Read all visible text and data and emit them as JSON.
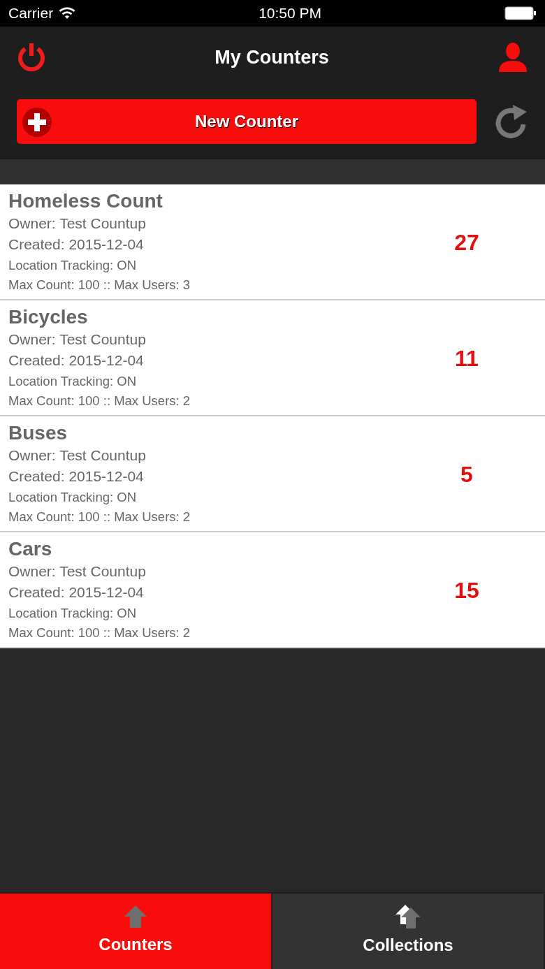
{
  "status_bar": {
    "carrier": "Carrier",
    "time": "10:50 PM"
  },
  "header": {
    "title": "My Counters",
    "new_button": "New Counter"
  },
  "counters": [
    {
      "name": "Homeless Count",
      "owner": "Owner: Test Countup",
      "created": "Created: 2015-12-04",
      "tracking": "Location Tracking: ON",
      "limits": "Max Count: 100 :: Max Users: 3",
      "count": "27"
    },
    {
      "name": "Bicycles",
      "owner": "Owner: Test Countup",
      "created": "Created: 2015-12-04",
      "tracking": "Location Tracking: ON",
      "limits": "Max Count: 100 :: Max Users: 2",
      "count": "11"
    },
    {
      "name": "Buses",
      "owner": "Owner: Test Countup",
      "created": "Created: 2015-12-04",
      "tracking": "Location Tracking: ON",
      "limits": "Max Count: 100 :: Max Users: 2",
      "count": "5"
    },
    {
      "name": "Cars",
      "owner": "Owner: Test Countup",
      "created": "Created: 2015-12-04",
      "tracking": "Location Tracking: ON",
      "limits": "Max Count: 100 :: Max Users: 2",
      "count": "15"
    }
  ],
  "tabs": [
    {
      "label": "Counters",
      "selected": true,
      "kind": "single"
    },
    {
      "label": "Collections",
      "selected": false,
      "kind": "stack"
    }
  ]
}
